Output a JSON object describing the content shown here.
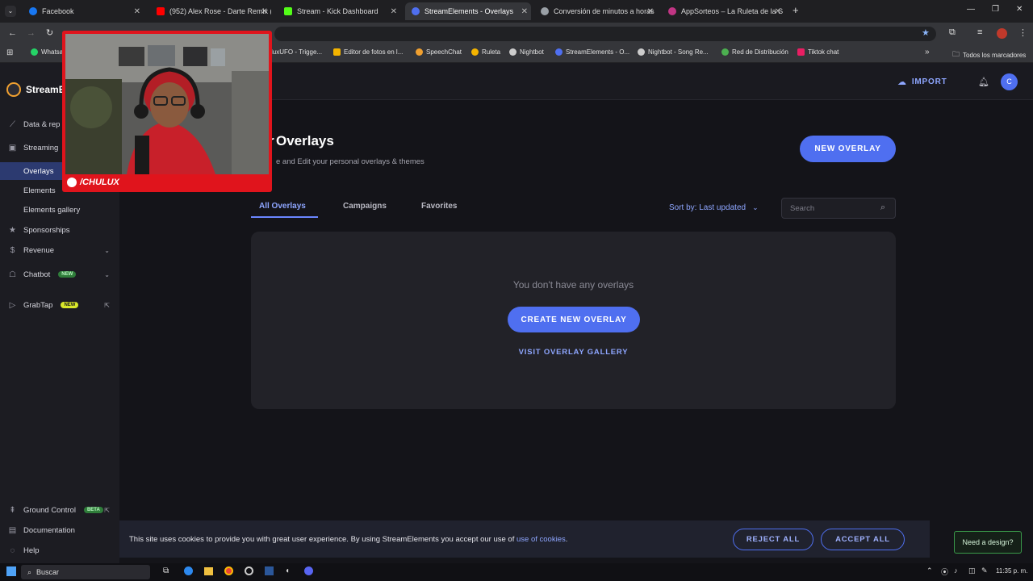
{
  "browser": {
    "tabs": [
      {
        "title": "Facebook",
        "color": "#1877f2",
        "active": false
      },
      {
        "title": "(952) Alex Rose - Darte Remix (",
        "color": "#ff0000",
        "active": false
      },
      {
        "title": "Stream - Kick Dashboard",
        "color": "#53fc18",
        "active": false
      },
      {
        "title": "StreamElements - Overlays",
        "color": "#4f6ff0",
        "active": true
      },
      {
        "title": "Conversión de minutos a horas",
        "color": "#9aa0a6",
        "active": false
      },
      {
        "title": "AppSorteos – La Ruleta de la S",
        "color": "#c13584",
        "active": false
      }
    ],
    "new_tab_label": "+",
    "bookmarks": [
      {
        "label": "Whatsa",
        "color": "#25d366"
      },
      {
        "label": "luxUFO - Trigge...",
        "color": "#888888"
      },
      {
        "label": "Editor de fotos en l...",
        "color": "#f4b400"
      },
      {
        "label": "SpeechChat",
        "color": "#f0a030"
      },
      {
        "label": "Ruleta",
        "color": "#f4b400"
      },
      {
        "label": "Nightbot",
        "color": "#cccccc"
      },
      {
        "label": "StreamElements - O...",
        "color": "#4f6ff0"
      },
      {
        "label": "Nightbot - Song Re...",
        "color": "#cccccc"
      },
      {
        "label": "Red de Distribución",
        "color": "#4caf50"
      },
      {
        "label": "Tiktok chat",
        "color": "#e91e63"
      }
    ],
    "all_bookmarks_label": "Todos los marcadores"
  },
  "app": {
    "brand": "StreamE",
    "sidebar": {
      "items": [
        {
          "label": "Data & rep",
          "icon": "chart-icon"
        },
        {
          "label": "Streaming",
          "icon": "streaming-icon"
        },
        {
          "label": "Overlays",
          "active": true
        },
        {
          "label": "Elements"
        },
        {
          "label": "Elements gallery"
        },
        {
          "label": "Sponsorships",
          "icon": "star-icon"
        },
        {
          "label": "Revenue",
          "icon": "dollar-icon"
        },
        {
          "label": "Chatbot",
          "icon": "chatbot-icon",
          "badge": "NEW"
        },
        {
          "label": "GrabTap",
          "icon": "grabtap-icon",
          "badge": "NEW"
        }
      ],
      "bottom": [
        {
          "label": "Ground Control",
          "badge": "BETA"
        },
        {
          "label": "Documentation"
        },
        {
          "label": "Help"
        }
      ]
    },
    "topbar": {
      "import_label": "IMPORT",
      "avatar_initial": "C"
    },
    "page": {
      "title": "Overlays",
      "title_prefix": "r",
      "subtitle": "e and Edit your personal overlays & themes",
      "new_overlay": "NEW OVERLAY",
      "tabs": [
        "All Overlays",
        "Campaigns",
        "Favorites"
      ],
      "sort_label": "Sort by: Last updated",
      "search_placeholder": "Search",
      "empty_text": "You don't have any overlays",
      "create_button": "CREATE NEW OVERLAY",
      "gallery_link": "VISIT OVERLAY GALLERY"
    },
    "cookie": {
      "text": "This site uses cookies to provide you with great user experience. By using StreamElements you accept our use of ",
      "link": "use of cookies",
      "suffix": ".",
      "reject": "REJECT ALL",
      "accept": "ACCEPT ALL"
    },
    "need_design": "Need a design?"
  },
  "webcam": {
    "name": "/CHULUX"
  },
  "taskbar": {
    "search": "Buscar",
    "time": "11:35 p. m."
  },
  "colors": {
    "accent": "#4f6ff0",
    "webcam_frame": "#e0141c",
    "new_badge": "#d9e82a"
  }
}
